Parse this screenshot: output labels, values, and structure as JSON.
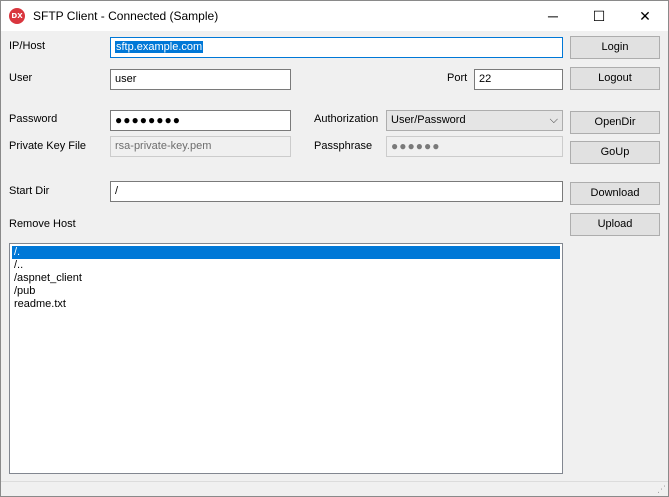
{
  "window": {
    "title": "SFTP Client - Connected (Sample)",
    "icon": "dx-app-icon",
    "controls": {
      "minimize": "─",
      "maximize": "☐",
      "close": "✕"
    }
  },
  "form": {
    "host_label": "IP/Host",
    "host_value": "sftp.example.com",
    "user_label": "User",
    "user_value": "user",
    "port_label": "Port",
    "port_value": "22",
    "password_label": "Password",
    "password_value": "●●●●●●●●",
    "authorization_label": "Authorization",
    "authorization_value": "User/Password",
    "private_key_label": "Private Key File",
    "private_key_value": "rsa-private-key.pem",
    "passphrase_label": "Passphrase",
    "passphrase_value": "●●●●●●",
    "start_dir_label": "Start Dir",
    "start_dir_value": "/",
    "remote_host_label": "Remove Host"
  },
  "buttons": {
    "login": "Login",
    "logout": "Logout",
    "opendir": "OpenDir",
    "goup": "GoUp",
    "download": "Download",
    "upload": "Upload"
  },
  "listing": {
    "items": [
      "/.",
      "/..",
      "/aspnet_client",
      "/pub",
      "readme.txt"
    ],
    "selected_index": 0
  },
  "colors": {
    "accent": "#0078d7",
    "title_background": "#ffffff",
    "window_background": "#f0f0f0"
  }
}
